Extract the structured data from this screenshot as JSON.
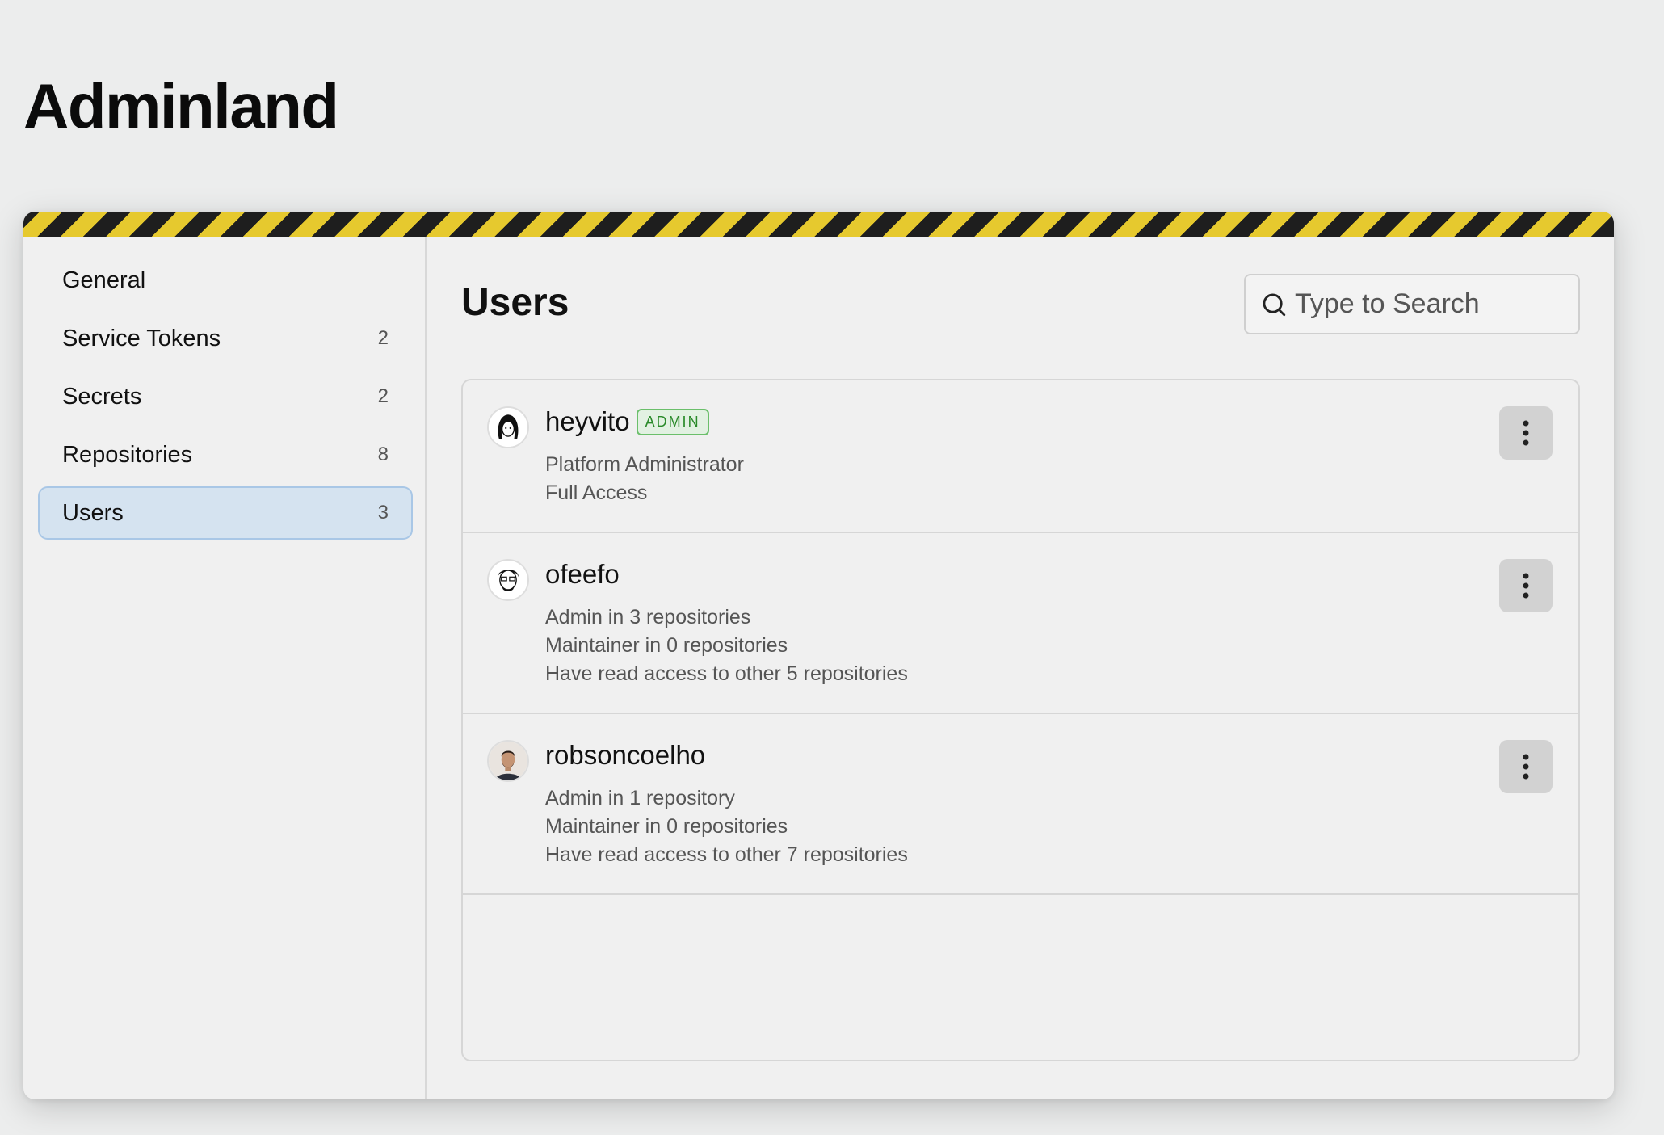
{
  "page": {
    "title": "Adminland"
  },
  "sidebar": {
    "items": [
      {
        "label": "General",
        "count": ""
      },
      {
        "label": "Service Tokens",
        "count": "2"
      },
      {
        "label": "Secrets",
        "count": "2"
      },
      {
        "label": "Repositories",
        "count": "8"
      },
      {
        "label": "Users",
        "count": "3",
        "active": true
      }
    ]
  },
  "main": {
    "title": "Users",
    "search": {
      "placeholder": "Type to Search",
      "icon": "search-icon"
    },
    "users": [
      {
        "name": "heyvito",
        "badge": "ADMIN",
        "details": [
          "Platform Administrator",
          "Full Access"
        ]
      },
      {
        "name": "ofeefo",
        "badge": "",
        "details": [
          "Admin in 3 repositories",
          "Maintainer in 0 repositories",
          "Have read access to other 5 repositories"
        ]
      },
      {
        "name": "robsoncoelho",
        "badge": "",
        "details": [
          "Admin in 1 repository",
          "Maintainer in 0 repositories",
          "Have read access to other 7 repositories"
        ]
      }
    ]
  },
  "colors": {
    "hazard_dark": "#1e1e1e",
    "hazard_yellow": "#e6c92e",
    "active_nav": "#d5e3f0",
    "admin_badge": "#2a8a2a"
  }
}
